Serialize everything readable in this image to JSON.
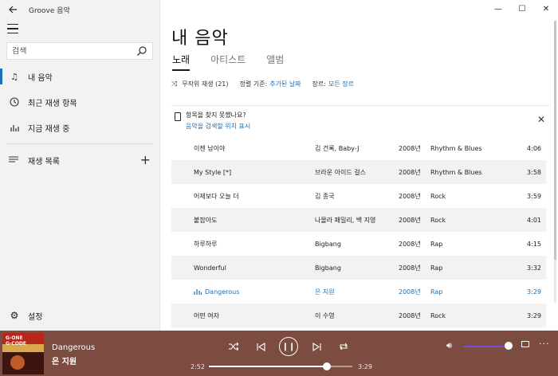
{
  "app": {
    "title": "Groove 음악"
  },
  "sidebar": {
    "search_placeholder": "검색",
    "items": [
      {
        "label": "내 음악",
        "icon": "music-note-icon",
        "active": true
      },
      {
        "label": "최근 재생 항목",
        "icon": "clock-icon"
      },
      {
        "label": "지금 재생 중",
        "icon": "bars-icon"
      }
    ],
    "playlists_label": "재생 목록",
    "settings_label": "설정"
  },
  "main": {
    "title": "내 음악",
    "tabs": [
      "노래",
      "아티스트",
      "앨범"
    ],
    "filter": {
      "shuffle_label": "무작위 재생 (21)",
      "sort_label": "정렬 기준:",
      "sort_value": "추가된 날짜",
      "genre_label": "장르:",
      "genre_value": "모든 장르"
    },
    "notice": {
      "question": "항목을 찾지 못했나요?",
      "link": "음악을 검색할 위치 표시"
    },
    "songs": [
      {
        "title": "이젠 남이야",
        "artist": "김 건록, Baby-J",
        "year": "2008년",
        "genre": "Rhythm & Blues",
        "duration": "4:06"
      },
      {
        "title": "My Style [*]",
        "artist": "브라운 아이드 걸스",
        "year": "2008년",
        "genre": "Rhythm & Blues",
        "duration": "3:58"
      },
      {
        "title": "어제보다 오늘 더",
        "artist": "김 종국",
        "year": "2008년",
        "genre": "Rock",
        "duration": "3:59"
      },
      {
        "title": "붙잡아도",
        "artist": "나몰라 패밀리, 백 지영",
        "year": "2008년",
        "genre": "Rock",
        "duration": "4:01"
      },
      {
        "title": "하루하루",
        "artist": "Bigbang",
        "year": "2008년",
        "genre": "Rap",
        "duration": "4:15"
      },
      {
        "title": "Wonderful",
        "artist": "Bigbang",
        "year": "2008년",
        "genre": "Rap",
        "duration": "3:32"
      },
      {
        "title": "Dangerous",
        "artist": "은 지원",
        "year": "2008년",
        "genre": "Rap",
        "duration": "3:29",
        "playing": true
      },
      {
        "title": "어떤 여자",
        "artist": "이 수영",
        "year": "2008년",
        "genre": "Rock",
        "duration": "3:29"
      }
    ]
  },
  "player": {
    "title": "Dangerous",
    "artist": "은 지원",
    "current_time": "2:52",
    "total_time": "3:29",
    "progress_fraction": 0.82,
    "volume_fraction": 1.0,
    "album_text": "G-ONE G-CODE"
  },
  "colors": {
    "accent": "#1e6fb3",
    "player_bg": "#7b4c3f"
  }
}
